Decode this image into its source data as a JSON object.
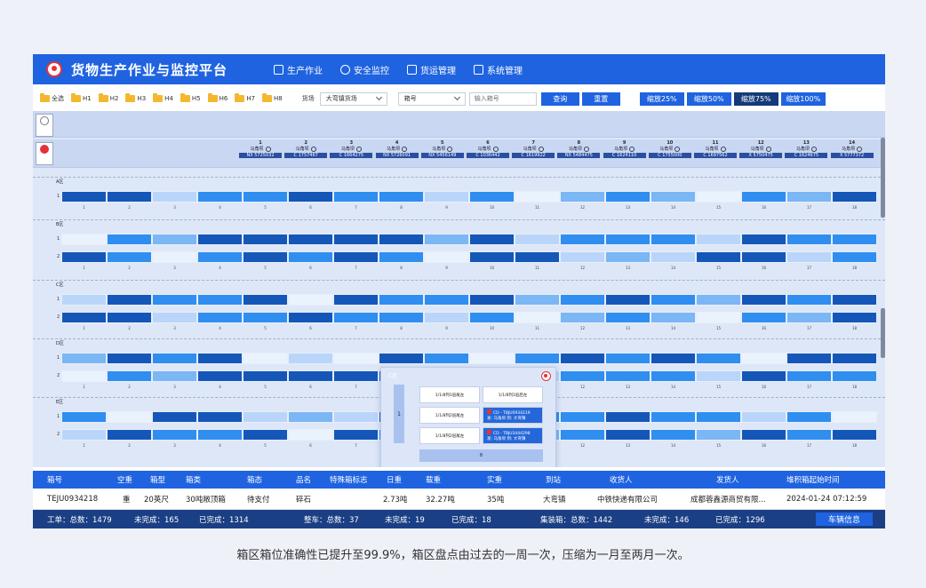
{
  "app": {
    "title": "货物生产作业与监控平台",
    "nav": [
      {
        "label": "生产作业",
        "icon": "doc-edit-icon"
      },
      {
        "label": "安全监控",
        "icon": "user-shield-icon"
      },
      {
        "label": "货运管理",
        "icon": "truck-icon"
      },
      {
        "label": "系统管理",
        "icon": "org-chart-icon"
      }
    ]
  },
  "toolbar": {
    "folders": [
      "全选",
      "H1",
      "H2",
      "H3",
      "H4",
      "H5",
      "H6",
      "H7",
      "H8"
    ],
    "yard_label": "货场",
    "yard_value": "大弯镇货场",
    "box_type_value": "箱号",
    "box_input_placeholder": "输入箱号",
    "query": "查询",
    "reset": "重置",
    "zoom": [
      "缩放25%",
      "缩放50%",
      "缩放75%",
      "缩放100%"
    ],
    "zoom_active_index": 2
  },
  "yard": {
    "zones": [
      "A区",
      "B区",
      "C区",
      "D区",
      "E区"
    ],
    "cranes": [
      {
        "num": "1",
        "label": "马角坝",
        "code": "NX 5725032"
      },
      {
        "num": "2",
        "label": "马角坝",
        "code": "C 1757467"
      },
      {
        "num": "3",
        "label": "马角坝",
        "code": "C 1664275"
      },
      {
        "num": "4",
        "label": "马角坝",
        "code": "NX 5726091"
      },
      {
        "num": "5",
        "label": "马角坝",
        "code": "NX 5456149"
      },
      {
        "num": "6",
        "label": "马角坝",
        "code": "C 1036442"
      },
      {
        "num": "7",
        "label": "马角坝",
        "code": "C 1619922"
      },
      {
        "num": "8",
        "label": "马角坝",
        "code": "NX 5484475"
      },
      {
        "num": "9",
        "label": "马角坝",
        "code": "C 1624110"
      },
      {
        "num": "10",
        "label": "马角坝",
        "code": "C 1755000"
      },
      {
        "num": "11",
        "label": "马角坝",
        "code": "C 1697562"
      },
      {
        "num": "12",
        "label": "马角坝",
        "code": "X 5750475"
      },
      {
        "num": "13",
        "label": "马角坝",
        "code": "C 1624675"
      },
      {
        "num": "14",
        "label": "马角坝",
        "code": "X 5777372"
      }
    ]
  },
  "popup": {
    "title": "C区",
    "stack": "1",
    "cells": [
      "1/1/8列1层尾左",
      "1/1/8列1层后左",
      "1/1/8列2层尾左",
      "1/1/8列2层尾左"
    ],
    "occupied": [
      {
        "code": "CD - TBJU0934219",
        "info": "发: 马角坝    到: 大弯镇"
      },
      {
        "code": "CD - TBJU3444298",
        "info": "发: 马角坝    到: 大弯镇"
      }
    ],
    "footer": "8"
  },
  "table": {
    "headers": [
      "箱号",
      "空重",
      "箱型",
      "箱类",
      "箱态",
      "品名",
      "特殊箱标志",
      "日重",
      "载重",
      "实重",
      "到站",
      "收货人",
      "发货人",
      "堆积箱起始时间"
    ],
    "row": [
      "TEJU0934218",
      "重",
      "20英尺",
      "30吨敞顶箱",
      "待支付",
      "碎石",
      "",
      "2.73吨",
      "32.27吨",
      "35吨",
      "大弯镇",
      "中铁快递有限公司",
      "成都蓉鑫源商贸有限...",
      "2024-01-24 07:12:59"
    ]
  },
  "status": {
    "work_total": "工单：总数：1479",
    "work_pending": "未完成：165",
    "work_done": "已完成：1314",
    "car_total": "整车：总数：37",
    "car_pending": "未完成：19",
    "car_done": "已完成：18",
    "box_total": "集装箱：总数：1442",
    "box_pending": "未完成：146",
    "box_done": "已完成：1296",
    "vehicle_button": "车辆信息"
  },
  "caption": "箱区箱位准确性已提升至99.9%，箱区盘点由过去的一周一次，压缩为一月至两月一次。",
  "colors": {
    "primary": "#1f63e0",
    "dark_navy": "#15397a",
    "status_bar": "#1b3f85",
    "slot_dark": "#1557b8",
    "slot_mid": "#2f8ef0",
    "slot_light": "#7bb6f5",
    "slot_pale": "#b9d6fa",
    "slot_empty": "#eaf2fd"
  }
}
